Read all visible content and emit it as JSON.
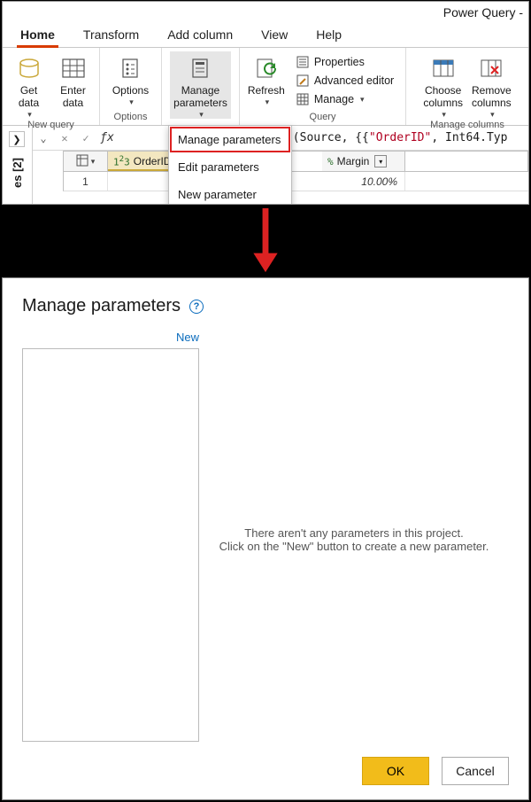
{
  "app_title": "Power Query -",
  "tabs": {
    "home": "Home",
    "transform": "Transform",
    "addcol": "Add column",
    "view": "View",
    "help": "Help"
  },
  "ribbon": {
    "get_data": "Get\ndata",
    "enter_data": "Enter\ndata",
    "options": "Options",
    "manage_params": "Manage\nparameters",
    "refresh": "Refresh",
    "properties": "Properties",
    "adv_editor": "Advanced editor",
    "manage": "Manage",
    "choose_cols": "Choose\ncolumns",
    "remove_cols": "Remove\ncolumns",
    "groups": {
      "newquery": "New query",
      "options": "Options",
      "query": "Query",
      "manage_cols": "Manage columns"
    }
  },
  "dropdown": {
    "manage": "Manage parameters",
    "edit": "Edit parameters",
    "newp": "New parameter"
  },
  "queries_label": "es [2]",
  "formula": {
    "pre": "mnTypes(Source, {{",
    "str": "\"OrderID\"",
    "post": ", Int64.Typ"
  },
  "grid": {
    "col1": "OrderID",
    "col2": "Margin",
    "row1_col2": "10.00%",
    "row1_num": "1"
  },
  "dialog": {
    "title": "Manage parameters",
    "new": "New",
    "empty1": "There aren't any parameters in this project.",
    "empty2": "Click on the \"New\" button to create a new parameter.",
    "ok": "OK",
    "cancel": "Cancel"
  }
}
